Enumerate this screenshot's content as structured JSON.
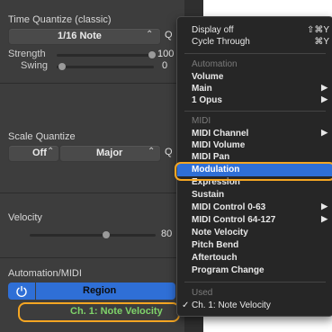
{
  "inspector": {
    "time_quantize": {
      "title": "Time Quantize (classic)",
      "value": "1/16 Note",
      "q_label": "Q",
      "strength_label": "Strength",
      "strength_value": "100",
      "swing_label": "Swing",
      "swing_value": "0"
    },
    "scale_quantize": {
      "title": "Scale Quantize",
      "root": "Off",
      "scale": "Major",
      "q_label": "Q"
    },
    "velocity": {
      "title": "Velocity",
      "value": "80"
    },
    "automation": {
      "title": "Automation/MIDI",
      "mode": "Region",
      "parameter": "Ch. 1: Note Velocity"
    }
  },
  "menu": {
    "top": [
      {
        "label": "Display off",
        "shortcut": "⇧⌘Y"
      },
      {
        "label": "Cycle Through",
        "shortcut": "⌘Y"
      }
    ],
    "automation_header": "Automation",
    "automation_items": [
      {
        "label": "Volume",
        "submenu": false
      },
      {
        "label": "Main",
        "submenu": true
      },
      {
        "label": "1 Opus",
        "submenu": true
      }
    ],
    "midi_header": "MIDI",
    "midi_items": [
      {
        "label": "MIDI Channel",
        "submenu": true
      },
      {
        "label": "MIDI Volume",
        "submenu": false
      },
      {
        "label": "MIDI Pan",
        "submenu": false
      },
      {
        "label": "Modulation",
        "submenu": false,
        "highlighted": true
      },
      {
        "label": "Expression",
        "submenu": false
      },
      {
        "label": "Sustain",
        "submenu": false
      },
      {
        "label": "MIDI Control 0-63",
        "submenu": true
      },
      {
        "label": "MIDI Control 64-127",
        "submenu": true
      },
      {
        "label": "Note Velocity",
        "submenu": false
      },
      {
        "label": "Pitch Bend",
        "submenu": false
      },
      {
        "label": "Aftertouch",
        "submenu": false
      },
      {
        "label": "Program Change",
        "submenu": false
      }
    ],
    "used_header": "Used",
    "used_items": [
      {
        "label": "Ch. 1: Note Velocity",
        "checked": true
      }
    ]
  },
  "colors": {
    "panel_bg": "#3d3d3d",
    "menu_bg": "#262626",
    "highlight": "#2f6fd6",
    "annotation": "#f5a623",
    "power_blue": "#2f6fd6",
    "green_text": "#7fd36a"
  },
  "icons": {
    "chevron": "up-down-chevron-icon",
    "power": "power-icon",
    "submenu": "submenu-arrow-icon",
    "check": "checkmark-icon"
  }
}
